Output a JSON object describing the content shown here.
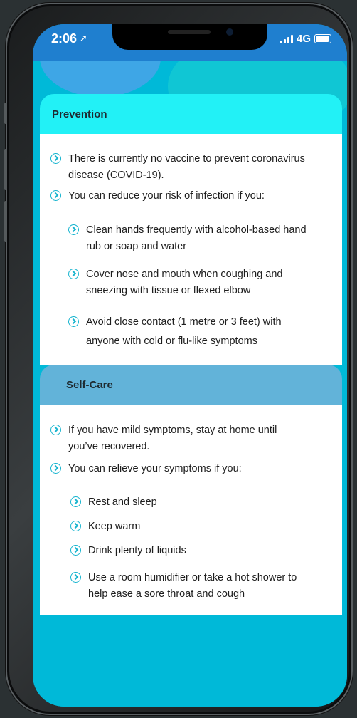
{
  "status_bar": {
    "time": "2:06",
    "network": "4G"
  },
  "prevention": {
    "title": "Prevention",
    "items": [
      "There is currently no vaccine to prevent coronavirus disease (COVID-19).",
      "You can reduce your risk of infection if you:"
    ],
    "subitems": [
      "Clean hands frequently with alcohol-based hand rub or soap and water",
      "Cover nose and mouth when coughing and sneezing with tissue or flexed elbow",
      "Avoid close contact (1 metre or 3 feet) with anyone with cold or flu-like symptoms"
    ]
  },
  "self_care": {
    "title": "Self-Care",
    "items": [
      "If you have mild symptoms, stay at home until you’ve recovered.",
      "You can relieve your symptoms if you:"
    ],
    "subitems": [
      "Rest and sleep",
      "Keep warm",
      "Drink plenty of liquids",
      "Use a room humidifier or take a hot shower to help ease a sore throat and cough"
    ]
  }
}
